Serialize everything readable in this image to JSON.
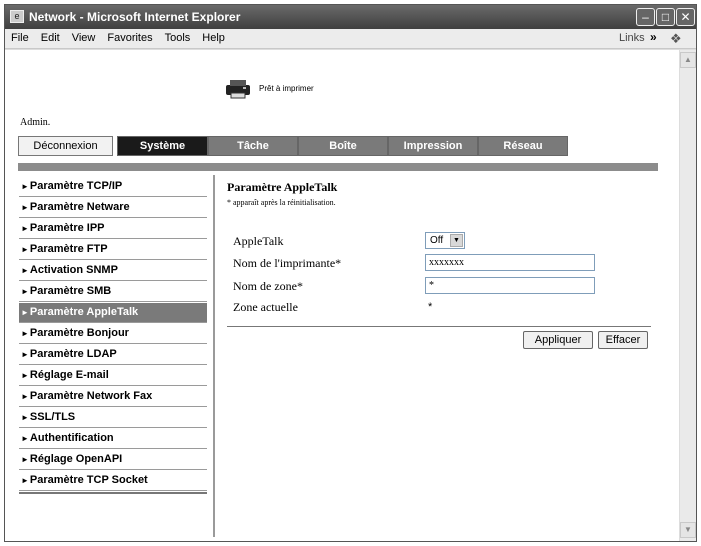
{
  "window": {
    "title": "Network - Microsoft Internet Explorer",
    "icon": "ie-page-icon",
    "controls": [
      "minimize",
      "maximize",
      "close"
    ]
  },
  "menubar": {
    "items": [
      "File",
      "Edit",
      "View",
      "Favorites",
      "Tools",
      "Help"
    ],
    "links_label": "Links",
    "links_chevron": "»"
  },
  "header": {
    "status_text": "Prêt à imprimer",
    "user_label": "Admin."
  },
  "tabs": [
    {
      "label": "Déconnexion"
    },
    {
      "label": "Système"
    },
    {
      "label": "Tâche"
    },
    {
      "label": "Boîte"
    },
    {
      "label": "Impression"
    },
    {
      "label": "Réseau"
    }
  ],
  "sidebar": {
    "items": [
      {
        "label": "Paramètre TCP/IP"
      },
      {
        "label": "Paramètre Netware"
      },
      {
        "label": "Paramètre IPP"
      },
      {
        "label": "Paramètre FTP"
      },
      {
        "label": "Activation SNMP"
      },
      {
        "label": "Paramètre SMB"
      },
      {
        "label": "Paramètre AppleTalk"
      },
      {
        "label": "Paramètre Bonjour"
      },
      {
        "label": "Paramètre LDAP"
      },
      {
        "label": "Réglage E-mail"
      },
      {
        "label": "Paramètre Network Fax"
      },
      {
        "label": "SSL/TLS"
      },
      {
        "label": "Authentification"
      },
      {
        "label": "Réglage OpenAPI"
      },
      {
        "label": "Paramètre TCP Socket"
      }
    ],
    "active_index": 6,
    "arrow": "►"
  },
  "panel": {
    "title": "Paramètre AppleTalk",
    "note": "* apparaît après la réinitialisation.",
    "fields": {
      "appletalk_label": "AppleTalk",
      "appletalk_value": "Off",
      "printer_name_label": "Nom de l'imprimante*",
      "printer_name_value": "xxxxxxx",
      "zone_label": "Nom de zone*",
      "zone_value": "*",
      "current_zone_label": "Zone actuelle",
      "current_zone_value": "*"
    },
    "apply_label": "Appliquer",
    "clear_label": "Effacer"
  },
  "colors": {
    "tab_active": "#1a1a1a",
    "tab_dim": "#7a7a7a",
    "sidebar_active": "#7a7a7a",
    "band": "#8c8c8c"
  }
}
